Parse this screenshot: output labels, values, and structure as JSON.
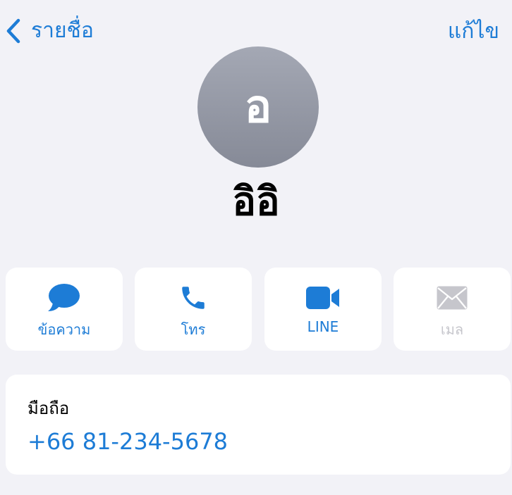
{
  "nav": {
    "back_label": "รายชื่อ",
    "edit_label": "แก้ไข"
  },
  "contact": {
    "initial": "อ",
    "name": "อิอิ"
  },
  "actions": [
    {
      "label": "ข้อความ",
      "icon": "message-bubble-icon",
      "enabled": true
    },
    {
      "label": "โทร",
      "icon": "phone-icon",
      "enabled": true
    },
    {
      "label": "LINE",
      "icon": "video-camera-icon",
      "enabled": true
    },
    {
      "label": "เมล",
      "icon": "envelope-icon",
      "enabled": false
    }
  ],
  "phone": {
    "label": "มือถือ",
    "number": "+66 81-234-5678"
  },
  "colors": {
    "accent": "#1D7CD6",
    "background": "#F2F2F7",
    "card": "#FFFFFF",
    "disabled": "#C6C6CC",
    "avatar_top": "#A4A8B4",
    "avatar_bottom": "#868A97"
  }
}
